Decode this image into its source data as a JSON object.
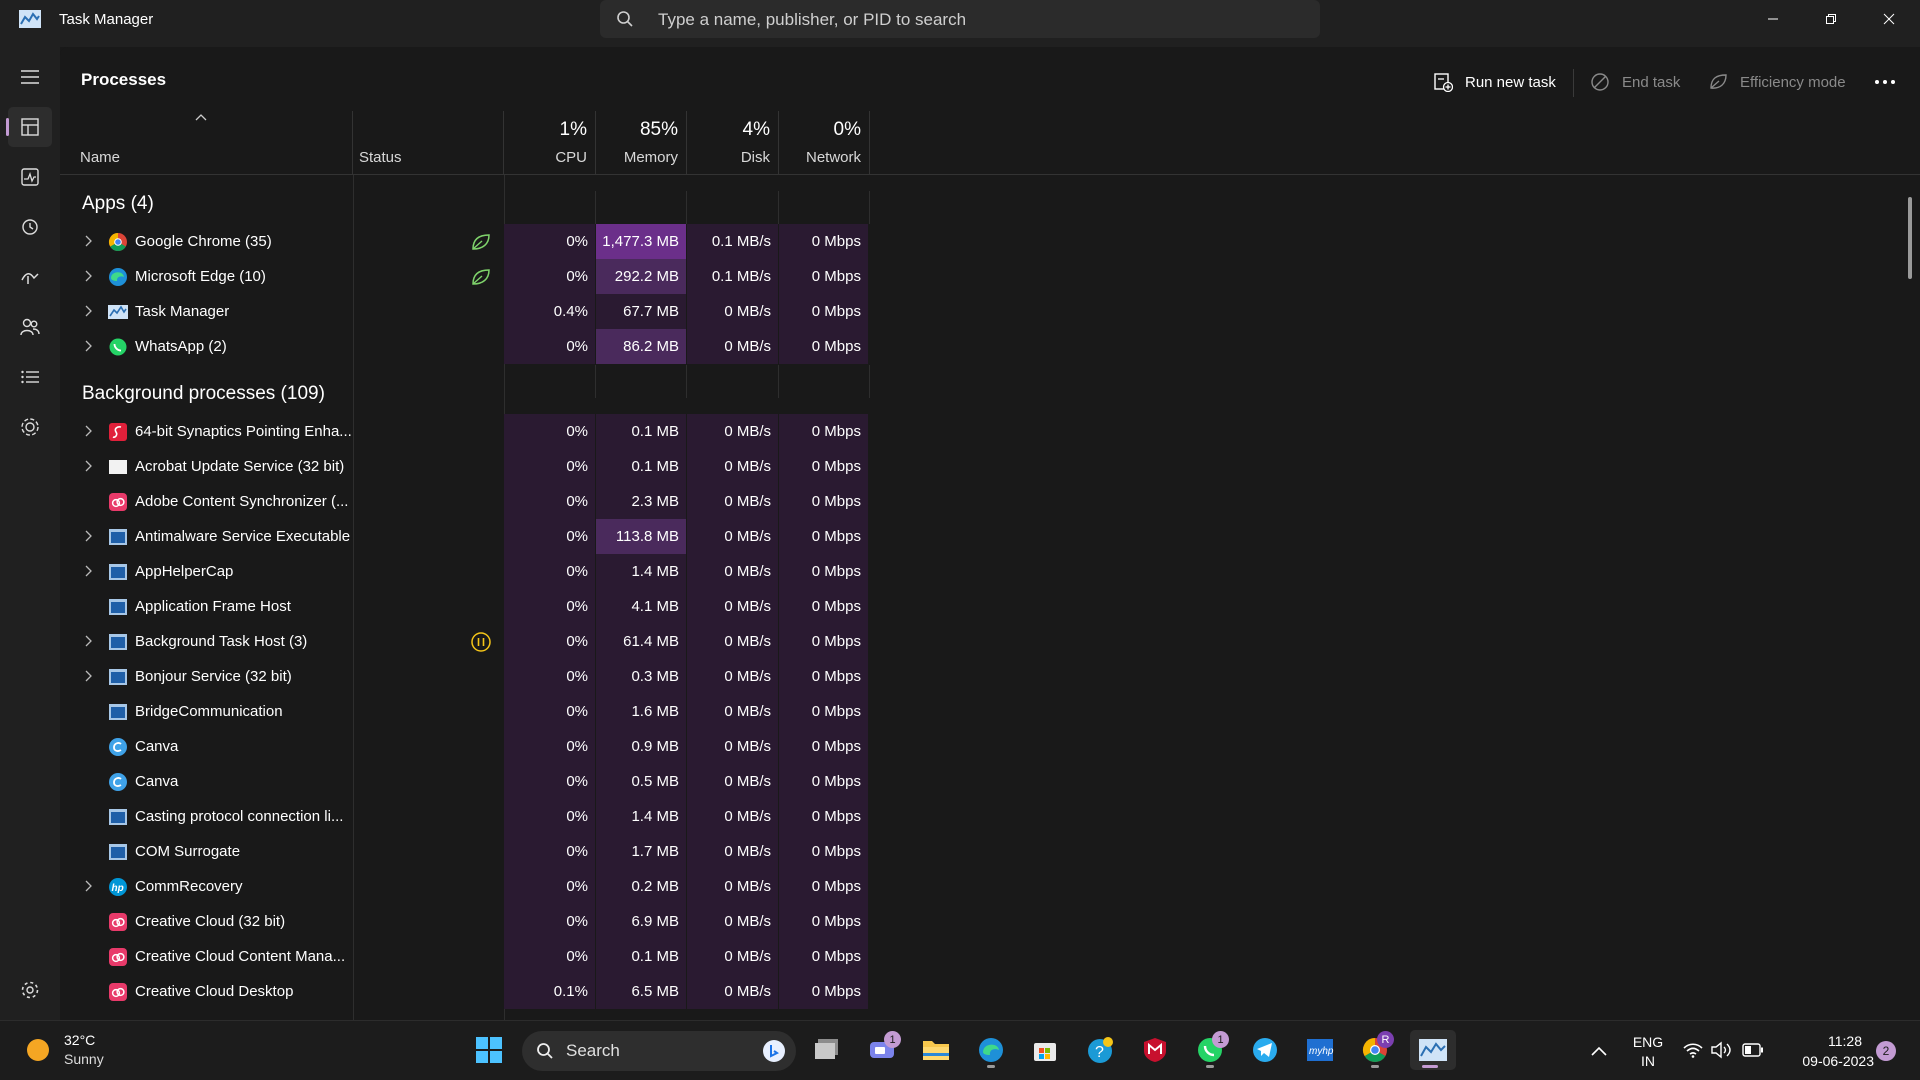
{
  "window": {
    "title": "Task Manager",
    "search_placeholder": "Type a name, publisher, or PID to search"
  },
  "page": {
    "title": "Processes",
    "run_new_task": "Run new task",
    "end_task": "End task",
    "efficiency_mode": "Efficiency mode"
  },
  "columns": {
    "name": "Name",
    "status": "Status",
    "cpu_pct": "1%",
    "cpu": "CPU",
    "memory_pct": "85%",
    "memory": "Memory",
    "disk_pct": "4%",
    "disk": "Disk",
    "network_pct": "0%",
    "network": "Network"
  },
  "groups": {
    "apps": "Apps (4)",
    "background": "Background processes (109)"
  },
  "apps": [
    {
      "name": "Google Chrome (35)",
      "icon": "chrome-icon",
      "expand": true,
      "status": "efficiency-leaf",
      "cpu": "0%",
      "mem": "1,477.3 MB",
      "disk": "0.1 MB/s",
      "net": "0 Mbps",
      "heat": 3
    },
    {
      "name": "Microsoft Edge (10)",
      "icon": "edge-icon",
      "expand": true,
      "status": "efficiency-leaf",
      "cpu": "0%",
      "mem": "292.2 MB",
      "disk": "0.1 MB/s",
      "net": "0 Mbps",
      "heat": 2
    },
    {
      "name": "Task Manager",
      "icon": "task-manager-icon",
      "expand": true,
      "status": "",
      "cpu": "0.4%",
      "mem": "67.7 MB",
      "disk": "0 MB/s",
      "net": "0 Mbps",
      "heat": 1
    },
    {
      "name": "WhatsApp (2)",
      "icon": "whatsapp-icon",
      "expand": true,
      "status": "",
      "cpu": "0%",
      "mem": "86.2 MB",
      "disk": "0 MB/s",
      "net": "0 Mbps",
      "heat": 2
    }
  ],
  "background": [
    {
      "name": "64-bit Synaptics Pointing Enha...",
      "icon": "synaptics-icon",
      "expand": true,
      "status": "",
      "cpu": "0%",
      "mem": "0.1 MB",
      "disk": "0 MB/s",
      "net": "0 Mbps",
      "heat": 1
    },
    {
      "name": "Acrobat Update Service (32 bit)",
      "icon": "acrobat-icon",
      "expand": true,
      "status": "",
      "cpu": "0%",
      "mem": "0.1 MB",
      "disk": "0 MB/s",
      "net": "0 Mbps",
      "heat": 1
    },
    {
      "name": "Adobe Content Synchronizer (...",
      "icon": "creative-cloud-icon",
      "expand": false,
      "status": "",
      "cpu": "0%",
      "mem": "2.3 MB",
      "disk": "0 MB/s",
      "net": "0 Mbps",
      "heat": 1
    },
    {
      "name": "Antimalware Service Executable",
      "icon": "window-app-icon",
      "expand": true,
      "status": "",
      "cpu": "0%",
      "mem": "113.8 MB",
      "disk": "0 MB/s",
      "net": "0 Mbps",
      "heat": 2
    },
    {
      "name": "AppHelperCap",
      "icon": "window-app-icon",
      "expand": true,
      "status": "",
      "cpu": "0%",
      "mem": "1.4 MB",
      "disk": "0 MB/s",
      "net": "0 Mbps",
      "heat": 1
    },
    {
      "name": "Application Frame Host",
      "icon": "window-app-icon",
      "expand": false,
      "status": "",
      "cpu": "0%",
      "mem": "4.1 MB",
      "disk": "0 MB/s",
      "net": "0 Mbps",
      "heat": 1
    },
    {
      "name": "Background Task Host (3)",
      "icon": "window-app-icon",
      "expand": true,
      "status": "suspended",
      "cpu": "0%",
      "mem": "61.4 MB",
      "disk": "0 MB/s",
      "net": "0 Mbps",
      "heat": 1
    },
    {
      "name": "Bonjour Service (32 bit)",
      "icon": "window-app-icon",
      "expand": true,
      "status": "",
      "cpu": "0%",
      "mem": "0.3 MB",
      "disk": "0 MB/s",
      "net": "0 Mbps",
      "heat": 1
    },
    {
      "name": "BridgeCommunication",
      "icon": "window-app-icon",
      "expand": false,
      "status": "",
      "cpu": "0%",
      "mem": "1.6 MB",
      "disk": "0 MB/s",
      "net": "0 Mbps",
      "heat": 1
    },
    {
      "name": "Canva",
      "icon": "canva-icon",
      "expand": false,
      "status": "",
      "cpu": "0%",
      "mem": "0.9 MB",
      "disk": "0 MB/s",
      "net": "0 Mbps",
      "heat": 1
    },
    {
      "name": "Canva",
      "icon": "canva-icon",
      "expand": false,
      "status": "",
      "cpu": "0%",
      "mem": "0.5 MB",
      "disk": "0 MB/s",
      "net": "0 Mbps",
      "heat": 1
    },
    {
      "name": "Casting protocol connection li...",
      "icon": "window-app-icon",
      "expand": false,
      "status": "",
      "cpu": "0%",
      "mem": "1.4 MB",
      "disk": "0 MB/s",
      "net": "0 Mbps",
      "heat": 1
    },
    {
      "name": "COM Surrogate",
      "icon": "window-app-icon",
      "expand": false,
      "status": "",
      "cpu": "0%",
      "mem": "1.7 MB",
      "disk": "0 MB/s",
      "net": "0 Mbps",
      "heat": 1
    },
    {
      "name": "CommRecovery",
      "icon": "hp-icon",
      "expand": true,
      "status": "",
      "cpu": "0%",
      "mem": "0.2 MB",
      "disk": "0 MB/s",
      "net": "0 Mbps",
      "heat": 1
    },
    {
      "name": "Creative Cloud (32 bit)",
      "icon": "creative-cloud-icon",
      "expand": false,
      "status": "",
      "cpu": "0%",
      "mem": "6.9 MB",
      "disk": "0 MB/s",
      "net": "0 Mbps",
      "heat": 1
    },
    {
      "name": "Creative Cloud Content Mana...",
      "icon": "creative-cloud-icon",
      "expand": false,
      "status": "",
      "cpu": "0%",
      "mem": "0.1 MB",
      "disk": "0 MB/s",
      "net": "0 Mbps",
      "heat": 1
    },
    {
      "name": "Creative Cloud Desktop",
      "icon": "creative-cloud-icon",
      "expand": false,
      "status": "",
      "cpu": "0.1%",
      "mem": "6.5 MB",
      "disk": "0 MB/s",
      "net": "0 Mbps",
      "heat": 1
    }
  ],
  "taskbar": {
    "temperature": "32°C",
    "weather": "Sunny",
    "search": "Search",
    "lang_top": "ENG",
    "lang_bottom": "IN",
    "time": "11:28",
    "date": "09-06-2023",
    "notifications": "2",
    "teams_badge": "1",
    "whatsapp_badge": "1",
    "chrome_badge": "R"
  },
  "colors": {
    "accent": "#c39bd3",
    "heat1": "#2a1a31",
    "heat2": "#4a2a5c",
    "heat3": "#6b2f8a"
  }
}
